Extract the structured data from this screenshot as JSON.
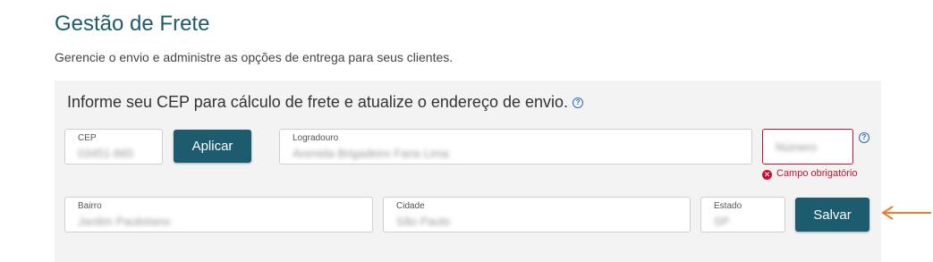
{
  "header": {
    "title": "Gestão de Frete",
    "subtitle": "Gerencie o envio e administre as opções de entrega para seus clientes."
  },
  "form": {
    "heading": "Informe seu CEP para cálculo de frete e atualize o endereço de envio.",
    "help_glyph": "?",
    "cep": {
      "label": "CEP",
      "value": "03451-865"
    },
    "apply_label": "Aplicar",
    "logradouro": {
      "label": "Logradouro",
      "value": "Avenida Brigadeiro Faria Lima"
    },
    "numero": {
      "placeholder": "Número"
    },
    "numero_error": "Campo obrigatório",
    "error_glyph": "✕",
    "bairro": {
      "label": "Bairro",
      "value": "Jardim Paulistano"
    },
    "cidade": {
      "label": "Cidade",
      "value": "São Paulo"
    },
    "estado": {
      "label": "Estado",
      "value": "SP"
    },
    "save_label": "Salvar"
  },
  "colors": {
    "primary": "#1d5c6e",
    "error": "#c8102e",
    "help": "#2a6bb3",
    "annotation_arrow": "#f07b2b"
  }
}
